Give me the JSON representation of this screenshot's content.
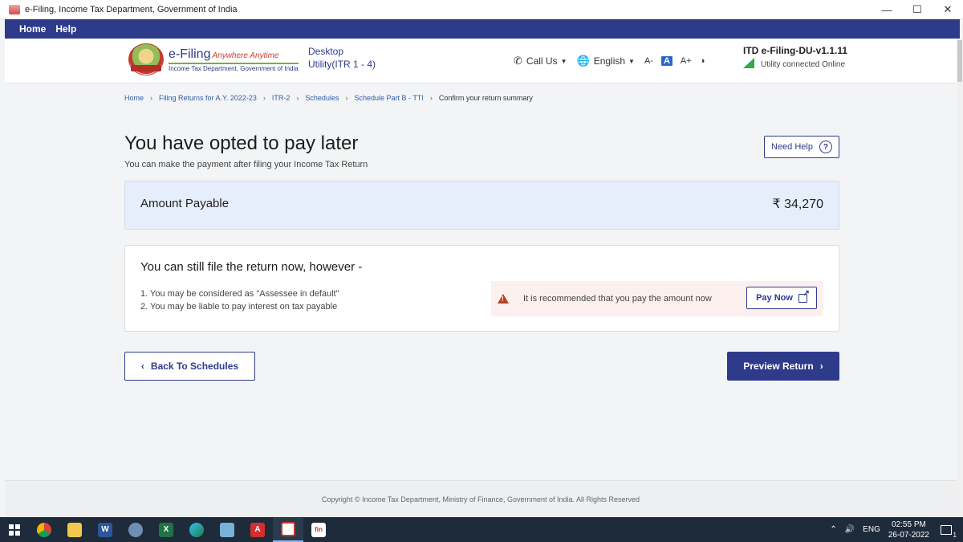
{
  "window": {
    "title": "e-Filing, Income Tax Department, Government of India",
    "minimize": "—",
    "maximize": "☐",
    "close": "✕"
  },
  "menu": {
    "items": [
      "Home",
      "Help"
    ]
  },
  "header": {
    "logo_main": "e-Filing",
    "logo_tagline": "Anywhere Anytime",
    "logo_sub": "Income Tax Department, Government of India",
    "desktop_line1": "Desktop",
    "desktop_line2": "Utility(ITR 1 - 4)",
    "call_us": "Call Us",
    "language": "English",
    "font_small": "A-",
    "font_normal": "A",
    "font_large": "A+",
    "version": "ITD e-Filing-DU-v1.1.11",
    "status": "Utility connected Online"
  },
  "breadcrumb": {
    "items": [
      "Home",
      "Filing Returns for A.Y. 2022-23",
      "ITR-2",
      "Schedules",
      "Schedule Part B - TTI"
    ],
    "current": "Confirm your return summary"
  },
  "main": {
    "title": "You have opted to pay later",
    "subtitle": "You can make the payment after filing your Income Tax Return",
    "need_help": "Need Help",
    "amount_label": "Amount Payable",
    "amount_value": "₹ 34,270",
    "still_title": "You can still file the return now, however -",
    "points": [
      "1. You may be considered as \"Assessee in default\"",
      "2. You may be liable to pay interest on tax payable"
    ],
    "recommend_text": "It is recommended that you pay the amount now",
    "pay_now": "Pay Now",
    "back_button": "Back To Schedules",
    "preview_button": "Preview Return"
  },
  "footer": {
    "copyright": "Copyright © Income Tax Department, Ministry of Finance, Government of India. All Rights Reserved"
  },
  "taskbar": {
    "language": "ENG",
    "time": "02:55 PM",
    "date": "26-07-2022",
    "notification_count": "1"
  },
  "colors": {
    "brand_navy": "#2e3b8b",
    "amount_bg": "#e6eefb",
    "warning": "#b8421e",
    "online_green": "#2fa84f"
  }
}
